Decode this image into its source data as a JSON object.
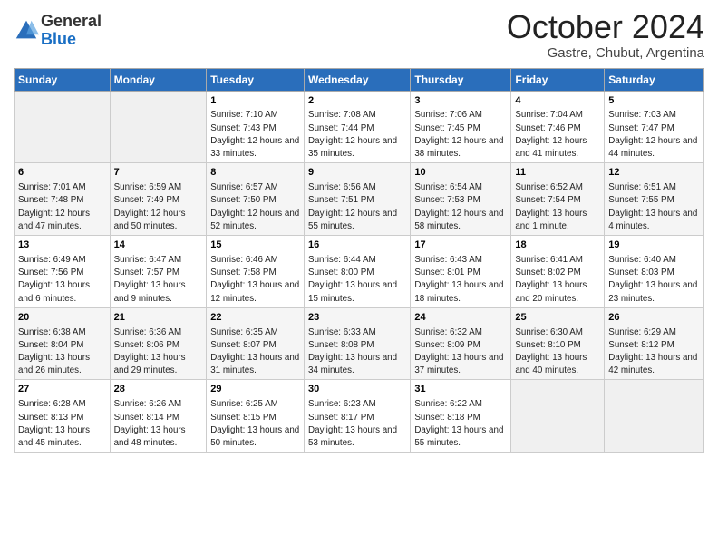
{
  "logo": {
    "general": "General",
    "blue": "Blue"
  },
  "title": "October 2024",
  "subtitle": "Gastre, Chubut, Argentina",
  "days_of_week": [
    "Sunday",
    "Monday",
    "Tuesday",
    "Wednesday",
    "Thursday",
    "Friday",
    "Saturday"
  ],
  "weeks": [
    [
      {
        "day": "",
        "sunrise": "",
        "sunset": "",
        "daylight": ""
      },
      {
        "day": "",
        "sunrise": "",
        "sunset": "",
        "daylight": ""
      },
      {
        "day": "1",
        "sunrise": "Sunrise: 7:10 AM",
        "sunset": "Sunset: 7:43 PM",
        "daylight": "Daylight: 12 hours and 33 minutes."
      },
      {
        "day": "2",
        "sunrise": "Sunrise: 7:08 AM",
        "sunset": "Sunset: 7:44 PM",
        "daylight": "Daylight: 12 hours and 35 minutes."
      },
      {
        "day": "3",
        "sunrise": "Sunrise: 7:06 AM",
        "sunset": "Sunset: 7:45 PM",
        "daylight": "Daylight: 12 hours and 38 minutes."
      },
      {
        "day": "4",
        "sunrise": "Sunrise: 7:04 AM",
        "sunset": "Sunset: 7:46 PM",
        "daylight": "Daylight: 12 hours and 41 minutes."
      },
      {
        "day": "5",
        "sunrise": "Sunrise: 7:03 AM",
        "sunset": "Sunset: 7:47 PM",
        "daylight": "Daylight: 12 hours and 44 minutes."
      }
    ],
    [
      {
        "day": "6",
        "sunrise": "Sunrise: 7:01 AM",
        "sunset": "Sunset: 7:48 PM",
        "daylight": "Daylight: 12 hours and 47 minutes."
      },
      {
        "day": "7",
        "sunrise": "Sunrise: 6:59 AM",
        "sunset": "Sunset: 7:49 PM",
        "daylight": "Daylight: 12 hours and 50 minutes."
      },
      {
        "day": "8",
        "sunrise": "Sunrise: 6:57 AM",
        "sunset": "Sunset: 7:50 PM",
        "daylight": "Daylight: 12 hours and 52 minutes."
      },
      {
        "day": "9",
        "sunrise": "Sunrise: 6:56 AM",
        "sunset": "Sunset: 7:51 PM",
        "daylight": "Daylight: 12 hours and 55 minutes."
      },
      {
        "day": "10",
        "sunrise": "Sunrise: 6:54 AM",
        "sunset": "Sunset: 7:53 PM",
        "daylight": "Daylight: 12 hours and 58 minutes."
      },
      {
        "day": "11",
        "sunrise": "Sunrise: 6:52 AM",
        "sunset": "Sunset: 7:54 PM",
        "daylight": "Daylight: 13 hours and 1 minute."
      },
      {
        "day": "12",
        "sunrise": "Sunrise: 6:51 AM",
        "sunset": "Sunset: 7:55 PM",
        "daylight": "Daylight: 13 hours and 4 minutes."
      }
    ],
    [
      {
        "day": "13",
        "sunrise": "Sunrise: 6:49 AM",
        "sunset": "Sunset: 7:56 PM",
        "daylight": "Daylight: 13 hours and 6 minutes."
      },
      {
        "day": "14",
        "sunrise": "Sunrise: 6:47 AM",
        "sunset": "Sunset: 7:57 PM",
        "daylight": "Daylight: 13 hours and 9 minutes."
      },
      {
        "day": "15",
        "sunrise": "Sunrise: 6:46 AM",
        "sunset": "Sunset: 7:58 PM",
        "daylight": "Daylight: 13 hours and 12 minutes."
      },
      {
        "day": "16",
        "sunrise": "Sunrise: 6:44 AM",
        "sunset": "Sunset: 8:00 PM",
        "daylight": "Daylight: 13 hours and 15 minutes."
      },
      {
        "day": "17",
        "sunrise": "Sunrise: 6:43 AM",
        "sunset": "Sunset: 8:01 PM",
        "daylight": "Daylight: 13 hours and 18 minutes."
      },
      {
        "day": "18",
        "sunrise": "Sunrise: 6:41 AM",
        "sunset": "Sunset: 8:02 PM",
        "daylight": "Daylight: 13 hours and 20 minutes."
      },
      {
        "day": "19",
        "sunrise": "Sunrise: 6:40 AM",
        "sunset": "Sunset: 8:03 PM",
        "daylight": "Daylight: 13 hours and 23 minutes."
      }
    ],
    [
      {
        "day": "20",
        "sunrise": "Sunrise: 6:38 AM",
        "sunset": "Sunset: 8:04 PM",
        "daylight": "Daylight: 13 hours and 26 minutes."
      },
      {
        "day": "21",
        "sunrise": "Sunrise: 6:36 AM",
        "sunset": "Sunset: 8:06 PM",
        "daylight": "Daylight: 13 hours and 29 minutes."
      },
      {
        "day": "22",
        "sunrise": "Sunrise: 6:35 AM",
        "sunset": "Sunset: 8:07 PM",
        "daylight": "Daylight: 13 hours and 31 minutes."
      },
      {
        "day": "23",
        "sunrise": "Sunrise: 6:33 AM",
        "sunset": "Sunset: 8:08 PM",
        "daylight": "Daylight: 13 hours and 34 minutes."
      },
      {
        "day": "24",
        "sunrise": "Sunrise: 6:32 AM",
        "sunset": "Sunset: 8:09 PM",
        "daylight": "Daylight: 13 hours and 37 minutes."
      },
      {
        "day": "25",
        "sunrise": "Sunrise: 6:30 AM",
        "sunset": "Sunset: 8:10 PM",
        "daylight": "Daylight: 13 hours and 40 minutes."
      },
      {
        "day": "26",
        "sunrise": "Sunrise: 6:29 AM",
        "sunset": "Sunset: 8:12 PM",
        "daylight": "Daylight: 13 hours and 42 minutes."
      }
    ],
    [
      {
        "day": "27",
        "sunrise": "Sunrise: 6:28 AM",
        "sunset": "Sunset: 8:13 PM",
        "daylight": "Daylight: 13 hours and 45 minutes."
      },
      {
        "day": "28",
        "sunrise": "Sunrise: 6:26 AM",
        "sunset": "Sunset: 8:14 PM",
        "daylight": "Daylight: 13 hours and 48 minutes."
      },
      {
        "day": "29",
        "sunrise": "Sunrise: 6:25 AM",
        "sunset": "Sunset: 8:15 PM",
        "daylight": "Daylight: 13 hours and 50 minutes."
      },
      {
        "day": "30",
        "sunrise": "Sunrise: 6:23 AM",
        "sunset": "Sunset: 8:17 PM",
        "daylight": "Daylight: 13 hours and 53 minutes."
      },
      {
        "day": "31",
        "sunrise": "Sunrise: 6:22 AM",
        "sunset": "Sunset: 8:18 PM",
        "daylight": "Daylight: 13 hours and 55 minutes."
      },
      {
        "day": "",
        "sunrise": "",
        "sunset": "",
        "daylight": ""
      },
      {
        "day": "",
        "sunrise": "",
        "sunset": "",
        "daylight": ""
      }
    ]
  ]
}
